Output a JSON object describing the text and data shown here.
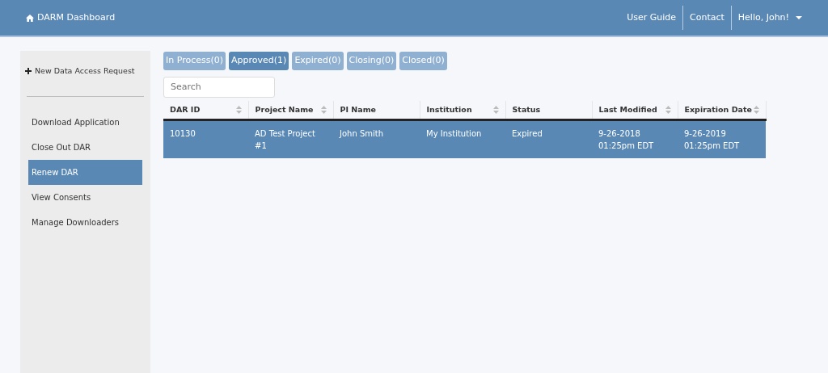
{
  "navbar": {
    "brand": "DARM Dashboard",
    "links": [
      {
        "label": "User Guide",
        "kind": "link"
      },
      {
        "label": "Contact",
        "kind": "link"
      },
      {
        "label": "Hello, John!",
        "kind": "dropdown"
      }
    ]
  },
  "sidebar": {
    "new_request": "New Data Access Request",
    "items": [
      {
        "label": "Download Application",
        "selected": false
      },
      {
        "label": "Close Out DAR",
        "selected": false
      },
      {
        "label": "Renew DAR",
        "selected": true
      },
      {
        "label": "View Consents",
        "selected": false
      },
      {
        "label": "Manage Downloaders",
        "selected": false
      }
    ]
  },
  "tabs": [
    {
      "label": "In Process(0)",
      "selected": false
    },
    {
      "label": "Approved(1)",
      "selected": true
    },
    {
      "label": "Expired(0)",
      "selected": false
    },
    {
      "label": "Closing(0)",
      "selected": false
    },
    {
      "label": "Closed(0)",
      "selected": false
    }
  ],
  "search": {
    "placeholder": "Search"
  },
  "table": {
    "columns": [
      {
        "label": "DAR ID",
        "sortable": true
      },
      {
        "label": "Project Name",
        "sortable": true
      },
      {
        "label": "PI Name",
        "sortable": false
      },
      {
        "label": "Institution",
        "sortable": true
      },
      {
        "label": "Status",
        "sortable": false
      },
      {
        "label": "Last Modified",
        "sortable": true
      },
      {
        "label": "Expiration Date",
        "sortable": true
      }
    ],
    "rows": [
      {
        "selected": true,
        "cells": [
          "10130",
          "AD Test Project #1",
          "John Smith",
          "My Institution",
          "Expired",
          "9-26-2018 01:25pm EDT",
          "9-26-2019 01:25pm EDT"
        ]
      }
    ]
  }
}
